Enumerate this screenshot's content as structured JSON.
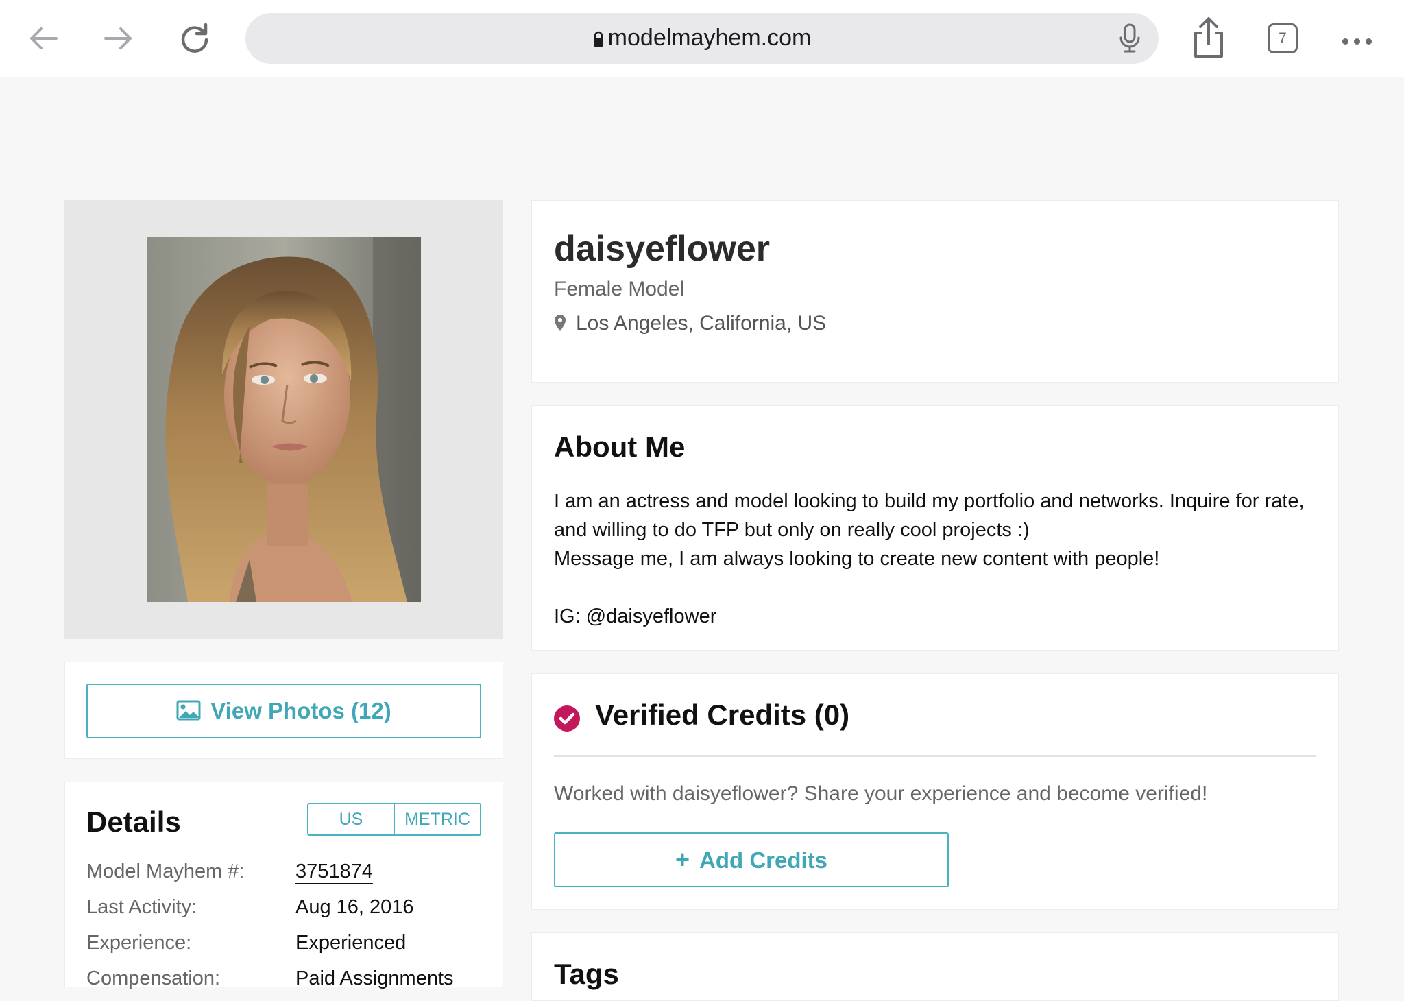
{
  "browser": {
    "url": "modelmayhem.com",
    "tab_count": "7"
  },
  "profile": {
    "username": "daisyeflower",
    "role": "Female Model",
    "location": "Los Angeles, California, US"
  },
  "view_photos_label": "View Photos (12)",
  "details": {
    "title": "Details",
    "unit_options": [
      "US",
      "METRIC"
    ],
    "rows": [
      {
        "label": "Model Mayhem #:",
        "value": "3751874"
      },
      {
        "label": "Last Activity:",
        "value": "Aug 16, 2016"
      },
      {
        "label": "Experience:",
        "value": "Experienced"
      },
      {
        "label": "Compensation:",
        "value": "Paid Assignments"
      }
    ]
  },
  "about": {
    "title": "About Me",
    "lines": [
      "I am an actress and model looking to build my portfolio and networks. Inquire for rate, and willing to do TFP but only on really cool projects :)",
      "Message me, I am always looking to create new content with people!",
      "",
      "IG: @daisyeflower"
    ]
  },
  "credits": {
    "title": "Verified Credits (0)",
    "prompt": "Worked with daisyeflower? Share your experience and become verified!",
    "add_label": "Add Credits"
  },
  "tags": {
    "title": "Tags"
  },
  "colors": {
    "accent": "#4ab3c1",
    "verified": "#c2185b"
  }
}
